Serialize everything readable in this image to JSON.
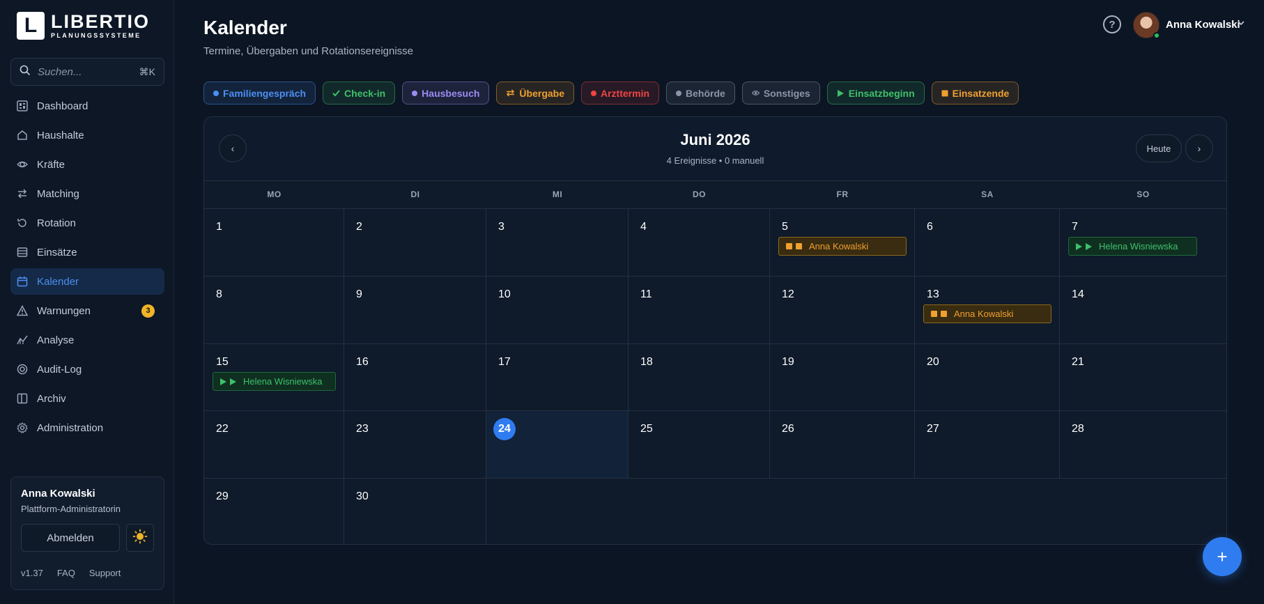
{
  "brand": {
    "logo_letter": "L",
    "name": "LIBERTIO",
    "tagline": "PLANUNGSSYSTEME"
  },
  "search": {
    "placeholder": "Suchen...",
    "shortcut": "⌘K"
  },
  "nav": [
    {
      "label": "Dashboard",
      "icon": "dashboard-icon"
    },
    {
      "label": "Haushalte",
      "icon": "home-icon"
    },
    {
      "label": "Kräfte",
      "icon": "workers-icon"
    },
    {
      "label": "Matching",
      "icon": "matching-icon"
    },
    {
      "label": "Rotation",
      "icon": "rotation-icon"
    },
    {
      "label": "Einsätze",
      "icon": "assignments-icon"
    },
    {
      "label": "Kalender",
      "icon": "calendar-icon",
      "active": true
    },
    {
      "label": "Warnungen",
      "icon": "warning-icon",
      "badge": "3"
    },
    {
      "label": "Analyse",
      "icon": "analytics-icon"
    },
    {
      "label": "Audit-Log",
      "icon": "audit-icon"
    },
    {
      "label": "Archiv",
      "icon": "archive-icon"
    },
    {
      "label": "Administration",
      "icon": "settings-icon"
    }
  ],
  "user_card": {
    "name": "Anna Kowalski",
    "role": "Plattform-Administratorin",
    "logout_label": "Abmelden",
    "version": "v1.37",
    "faq": "FAQ",
    "support": "Support"
  },
  "header": {
    "title": "Kalender",
    "subtitle": "Termine, Übergaben und Rotationsereignisse",
    "help": "?",
    "user_name": "Anna Kowalski"
  },
  "filters": [
    {
      "label": "Familiengespräch",
      "marker": "dot",
      "color": "#4c8ff2"
    },
    {
      "label": "Check-in",
      "marker": "check",
      "color": "#3fc06a"
    },
    {
      "label": "Hausbesuch",
      "marker": "dot",
      "color": "#9b8cf2"
    },
    {
      "label": "Übergabe",
      "marker": "swap",
      "color": "#f0a030"
    },
    {
      "label": "Arzttermin",
      "marker": "dot",
      "color": "#ef4444"
    },
    {
      "label": "Behörde",
      "marker": "dot",
      "color": "#8a95a6"
    },
    {
      "label": "Sonstiges",
      "marker": "eye",
      "color": "#8a95a6"
    },
    {
      "label": "Einsatzbeginn",
      "marker": "play",
      "color": "#3fc06a"
    },
    {
      "label": "Einsatzende",
      "marker": "square",
      "color": "#f0a030"
    }
  ],
  "calendar": {
    "month_title": "Juni 2026",
    "summary": "4 Ereignisse • 0 manuell",
    "today_label": "Heute",
    "prev": "‹",
    "next": "›",
    "weekdays": [
      "MO",
      "DI",
      "MI",
      "DO",
      "FR",
      "SA",
      "SO"
    ],
    "today": "24",
    "days": [
      "1",
      "2",
      "3",
      "4",
      "5",
      "6",
      "7",
      "8",
      "9",
      "10",
      "11",
      "12",
      "13",
      "14",
      "15",
      "16",
      "17",
      "18",
      "19",
      "20",
      "21",
      "22",
      "23",
      "24",
      "25",
      "26",
      "27",
      "28",
      "29",
      "30"
    ],
    "events": [
      {
        "day": "5",
        "name": "Anna Kowalski",
        "kind": "einsatzende"
      },
      {
        "day": "7",
        "name": "Helena Wisniewska",
        "kind": "einsatzbeginn"
      },
      {
        "day": "13",
        "name": "Anna Kowalski",
        "kind": "einsatzende"
      },
      {
        "day": "15",
        "name": "Helena Wisniewska",
        "kind": "einsatzbeginn"
      }
    ]
  },
  "fab": "+"
}
